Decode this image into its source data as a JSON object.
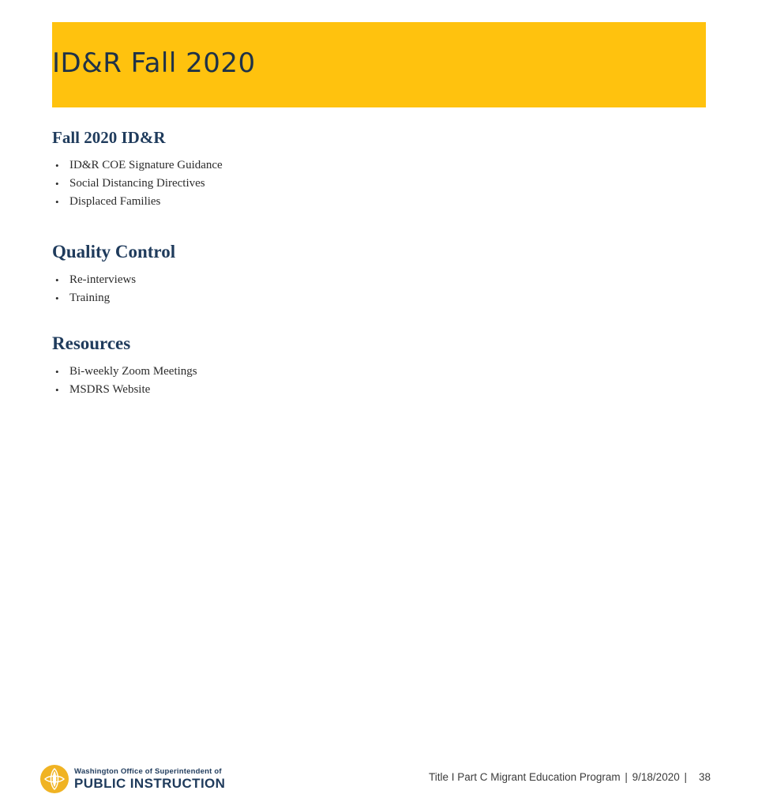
{
  "slide": {
    "title": "ID&R Fall 2020",
    "title_band_color": "#ffc20e",
    "heading_color": "#1f3b5c",
    "sections": [
      {
        "heading": "Fall 2020 ID&R",
        "bullets": [
          "ID&R COE Signature Guidance",
          "Social Distancing Directives",
          "Displaced Families"
        ]
      },
      {
        "heading": "Quality Control",
        "bullets": [
          "Re-interviews",
          "Training"
        ]
      },
      {
        "heading": "Resources",
        "bullets": [
          "Bi-weekly Zoom Meetings",
          "MSDRS Website"
        ]
      }
    ]
  },
  "footer": {
    "logo_line1": "Washington Office of Superintendent of",
    "logo_line2": "PUBLIC INSTRUCTION",
    "logo_icon": "ospi-sunburst-logo-icon",
    "program_text": "Title I Part C Migrant Education Program",
    "date_text": "9/18/2020",
    "separator_left": "|",
    "separator_right": "|",
    "page_number": "38"
  },
  "bullet_glyph": "•"
}
